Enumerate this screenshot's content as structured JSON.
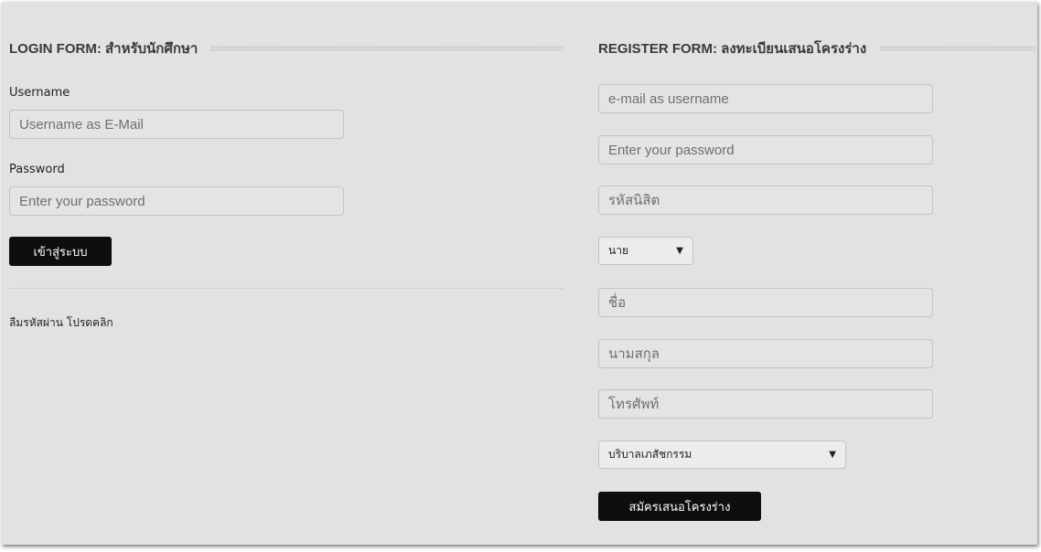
{
  "login": {
    "title": "LOGIN FORM: สำหรับนักศึกษา",
    "username_label": "Username",
    "username_placeholder": "Username as E-Mail",
    "password_label": "Password",
    "password_placeholder": "Enter your password",
    "submit_label": "เข้าสู่ระบบ",
    "forgot_text": "ลืมรหัสผ่าน",
    "forgot_link": "โปรดคลิก"
  },
  "register": {
    "title": "REGISTER FORM: ลงทะเบียนเสนอโครงร่าง",
    "email_placeholder": "e-mail as username",
    "password_placeholder": "Enter your password",
    "student_id_placeholder": "รหัสนิสิต",
    "prefix_selected": "นาย",
    "first_name_placeholder": "ชื่อ",
    "last_name_placeholder": "นามสกุล",
    "phone_placeholder": "โทรศัพท์",
    "faculty_selected": "บริบาลเภสัชกรรม",
    "submit_label": "สมัครเสนอโครงร่าง"
  }
}
